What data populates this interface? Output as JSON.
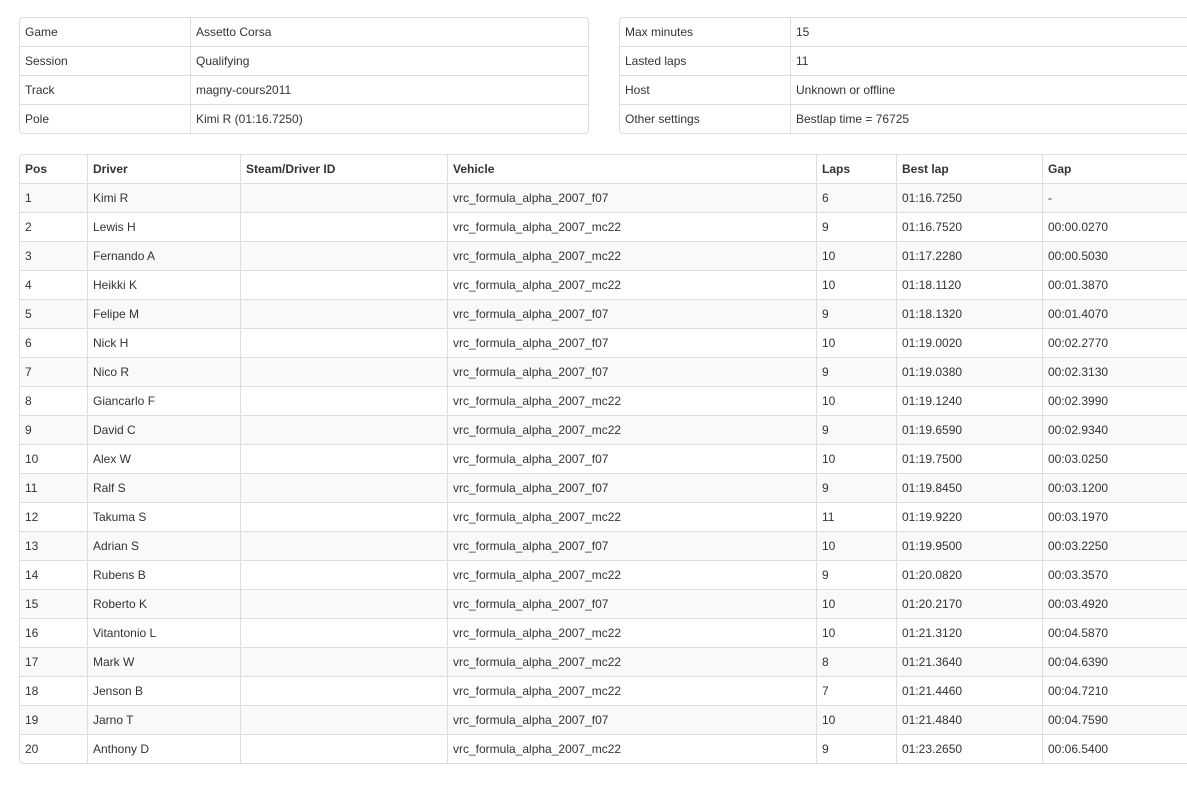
{
  "session_info_left": [
    {
      "label": "Game",
      "value": "Assetto Corsa"
    },
    {
      "label": "Session",
      "value": "Qualifying"
    },
    {
      "label": "Track",
      "value": "magny-cours2011"
    },
    {
      "label": "Pole",
      "value": "Kimi R (01:16.7250)"
    }
  ],
  "session_info_right": [
    {
      "label": "Max minutes",
      "value": "15"
    },
    {
      "label": "Lasted laps",
      "value": "11"
    },
    {
      "label": "Host",
      "value": "Unknown or offline"
    },
    {
      "label": "Other settings",
      "value": "Bestlap time = 76725"
    }
  ],
  "results": {
    "headers": [
      "Pos",
      "Driver",
      "Steam/Driver ID",
      "Vehicle",
      "Laps",
      "Best lap",
      "Gap"
    ],
    "rows": [
      {
        "pos": "1",
        "driver": "Kimi R",
        "id": "",
        "vehicle": "vrc_formula_alpha_2007_f07",
        "laps": "6",
        "best": "01:16.7250",
        "gap": "-"
      },
      {
        "pos": "2",
        "driver": "Lewis H",
        "id": "",
        "vehicle": "vrc_formula_alpha_2007_mc22",
        "laps": "9",
        "best": "01:16.7520",
        "gap": "00:00.0270"
      },
      {
        "pos": "3",
        "driver": "Fernando A",
        "id": "",
        "vehicle": "vrc_formula_alpha_2007_mc22",
        "laps": "10",
        "best": "01:17.2280",
        "gap": "00:00.5030"
      },
      {
        "pos": "4",
        "driver": "Heikki K",
        "id": "",
        "vehicle": "vrc_formula_alpha_2007_mc22",
        "laps": "10",
        "best": "01:18.1120",
        "gap": "00:01.3870"
      },
      {
        "pos": "5",
        "driver": "Felipe M",
        "id": "",
        "vehicle": "vrc_formula_alpha_2007_f07",
        "laps": "9",
        "best": "01:18.1320",
        "gap": "00:01.4070"
      },
      {
        "pos": "6",
        "driver": "Nick H",
        "id": "",
        "vehicle": "vrc_formula_alpha_2007_f07",
        "laps": "10",
        "best": "01:19.0020",
        "gap": "00:02.2770"
      },
      {
        "pos": "7",
        "driver": "Nico R",
        "id": "",
        "vehicle": "vrc_formula_alpha_2007_f07",
        "laps": "9",
        "best": "01:19.0380",
        "gap": "00:02.3130"
      },
      {
        "pos": "8",
        "driver": "Giancarlo F",
        "id": "",
        "vehicle": "vrc_formula_alpha_2007_mc22",
        "laps": "10",
        "best": "01:19.1240",
        "gap": "00:02.3990"
      },
      {
        "pos": "9",
        "driver": "David C",
        "id": "",
        "vehicle": "vrc_formula_alpha_2007_mc22",
        "laps": "9",
        "best": "01:19.6590",
        "gap": "00:02.9340"
      },
      {
        "pos": "10",
        "driver": "Alex W",
        "id": "",
        "vehicle": "vrc_formula_alpha_2007_f07",
        "laps": "10",
        "best": "01:19.7500",
        "gap": "00:03.0250"
      },
      {
        "pos": "11",
        "driver": "Ralf S",
        "id": "",
        "vehicle": "vrc_formula_alpha_2007_f07",
        "laps": "9",
        "best": "01:19.8450",
        "gap": "00:03.1200"
      },
      {
        "pos": "12",
        "driver": "Takuma S",
        "id": "",
        "vehicle": "vrc_formula_alpha_2007_mc22",
        "laps": "11",
        "best": "01:19.9220",
        "gap": "00:03.1970"
      },
      {
        "pos": "13",
        "driver": "Adrian S",
        "id": "",
        "vehicle": "vrc_formula_alpha_2007_f07",
        "laps": "10",
        "best": "01:19.9500",
        "gap": "00:03.2250"
      },
      {
        "pos": "14",
        "driver": "Rubens B",
        "id": "",
        "vehicle": "vrc_formula_alpha_2007_mc22",
        "laps": "9",
        "best": "01:20.0820",
        "gap": "00:03.3570"
      },
      {
        "pos": "15",
        "driver": "Roberto K",
        "id": "",
        "vehicle": "vrc_formula_alpha_2007_f07",
        "laps": "10",
        "best": "01:20.2170",
        "gap": "00:03.4920"
      },
      {
        "pos": "16",
        "driver": "Vitantonio L",
        "id": "",
        "vehicle": "vrc_formula_alpha_2007_mc22",
        "laps": "10",
        "best": "01:21.3120",
        "gap": "00:04.5870"
      },
      {
        "pos": "17",
        "driver": "Mark W",
        "id": "",
        "vehicle": "vrc_formula_alpha_2007_mc22",
        "laps": "8",
        "best": "01:21.3640",
        "gap": "00:04.6390"
      },
      {
        "pos": "18",
        "driver": "Jenson B",
        "id": "",
        "vehicle": "vrc_formula_alpha_2007_mc22",
        "laps": "7",
        "best": "01:21.4460",
        "gap": "00:04.7210"
      },
      {
        "pos": "19",
        "driver": "Jarno T",
        "id": "",
        "vehicle": "vrc_formula_alpha_2007_f07",
        "laps": "10",
        "best": "01:21.4840",
        "gap": "00:04.7590"
      },
      {
        "pos": "20",
        "driver": "Anthony D",
        "id": "",
        "vehicle": "vrc_formula_alpha_2007_mc22",
        "laps": "9",
        "best": "01:23.2650",
        "gap": "00:06.5400"
      }
    ]
  }
}
